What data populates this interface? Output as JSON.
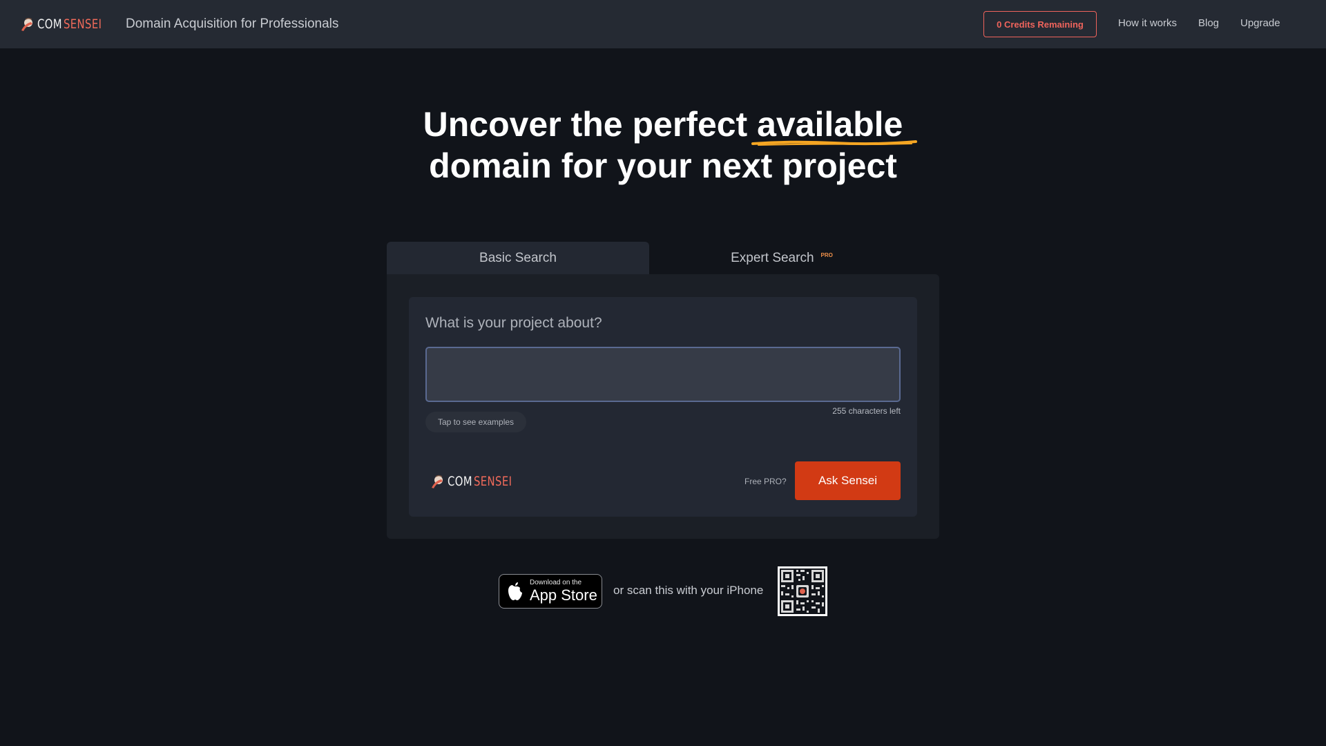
{
  "header": {
    "logo_com": "COM",
    "logo_sensei": "SENSEI",
    "tagline": "Domain Acquisition for Professionals",
    "credits_label": "0 Credits Remaining",
    "nav": [
      "How it works",
      "Blog",
      "Upgrade"
    ]
  },
  "hero": {
    "line1_start": "Uncover the perfect ",
    "line1_highlight": "available",
    "line2": "domain for your next project",
    "highlight_color": "#f5a623"
  },
  "tabs": {
    "basic": "Basic Search",
    "expert": "Expert Search",
    "pro_badge": "PRO"
  },
  "form": {
    "question": "What is your project about?",
    "input_value": "",
    "chars_left": "255 characters left",
    "examples_label": "Tap to see examples",
    "free_pro_label": "Free PRO?",
    "submit_label": "Ask Sensei"
  },
  "footer": {
    "appstore_small": "Download on the",
    "appstore_big": "App Store",
    "scan_text": "or scan this with your iPhone"
  },
  "colors": {
    "accent": "#d23a14",
    "brand_red": "#f06a5a",
    "background": "#11141a"
  }
}
